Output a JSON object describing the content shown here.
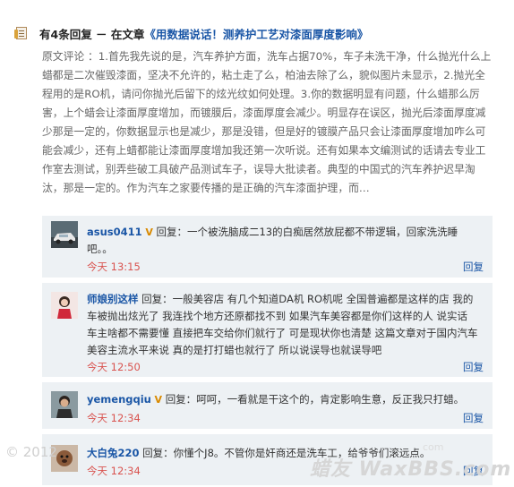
{
  "header": {
    "title": "有4条回复 － 在文章",
    "article_link": "《用数据说话！测养护工艺对漆面厚度影响》"
  },
  "original_comment": "原文评论 ：1.首先我先说的是，汽车养护方面，洗车占据70%，车子未洗干净，什么抛光什么上蜡都是二次催毁漆面，坚决不允许的，粘土走了么，柏油去除了么，貌似图片未显示，2.抛光全程用的是RO机，请问你抛光后留下的炫光纹如何处理。3.你的数据明显有问题，什么蜡那么厉害，上个蜡会让漆面厚度增加，而镀膜后，漆面厚度会减少。明显存在误区，抛光后漆面厚度减少那是一定的，你数据显示也是减少，那是没错，但是好的镀膜产品只会让漆面厚度增加咋么可能会减少，还有上蜡都能让漆面厚度增加我还第一次听说。还有如果本文编测试的话请去专业工作室去测试，别弄些破工具破产品测试车子，误导大批读者。典型的中国式的汽车养护迟早淘汰，那是一定的。作为汽车之家要传播的是正确的汽车漆面护理，而…",
  "replies": [
    {
      "username": "asus0411",
      "verified": "V",
      "content": "回复：一个被洗脑成二13的白痴居然放屁都不带逻辑，回家洗洗睡吧。。",
      "time": "今天 13:15",
      "reply_label": "回复"
    },
    {
      "username": "师娘别这样",
      "verified": "",
      "content": "回复：一般美容店 有几个知道DA机 RO机呢 全国普遍都是这样的店 我的车被抛出炫光了 我连找个地方还原都找不到 如果汽车美容都是你们这样的人 说实话 车主啥都不需要懂 直接把车交给你们就行了 可是现状你也清楚 这篇文章对于国内汽车美容主流水平来说 真的是打打蜡也就行了 所以说误导也就误导吧",
      "time": "今天 12:50",
      "reply_label": "回复"
    },
    {
      "username": "yemengqiu",
      "verified": "V",
      "content": "回复：呵呵，一看就是干这个的，肯定影响生意，反正我只打蜡。",
      "time": "今天 12:34",
      "reply_label": "回复"
    },
    {
      "username": "大白兔220",
      "verified": "",
      "content": "回复：你懂个J8。不管你是奸商还是洗车工，给爷爷们滚远点。",
      "time": "今天 12:34",
      "reply_label": "回复"
    }
  ],
  "watermark": {
    "copyright": "© 2012",
    "text": "蜡友 WaxBBS.com",
    "sub": "com"
  },
  "colors": {
    "link": "#1a56a6",
    "time": "#d9534f",
    "reply_bg": "#edf1f4",
    "verified_badge": "#d98a00"
  }
}
